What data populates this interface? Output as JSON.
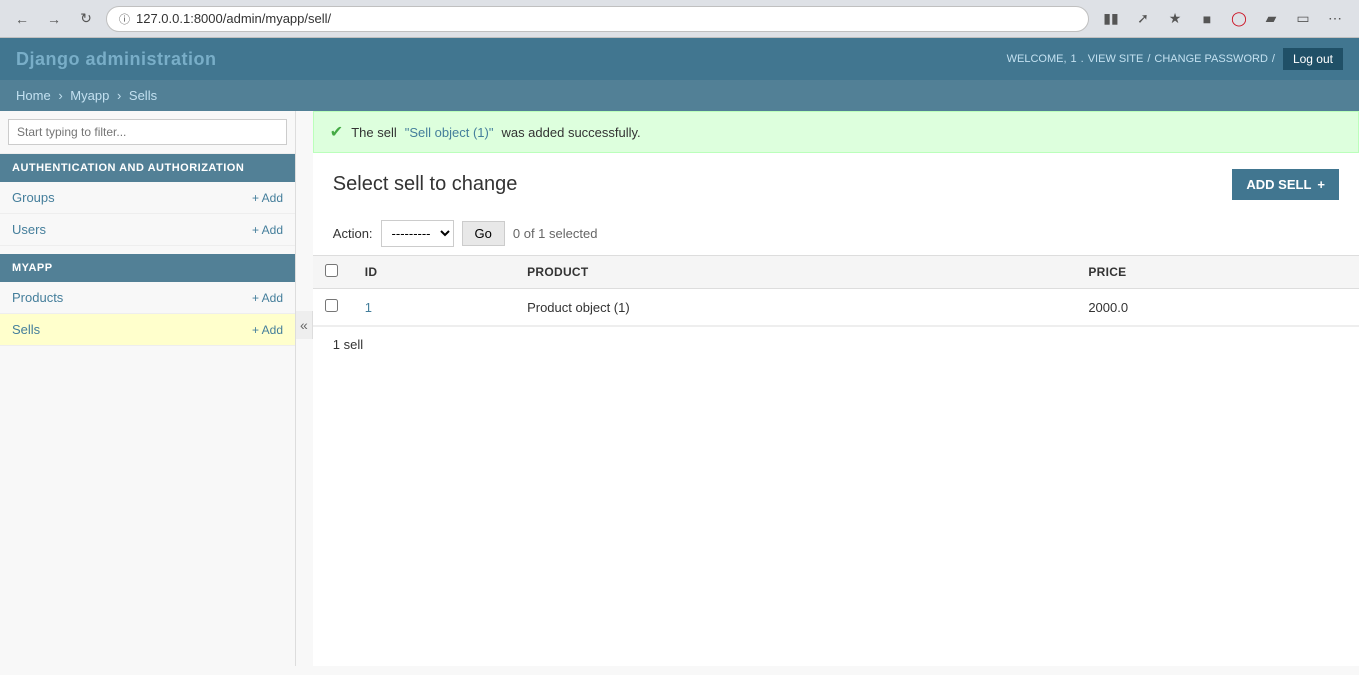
{
  "browser": {
    "url": "127.0.0.1:8000/admin/myapp/sell/",
    "url_full": "127.0.0.1:8000/admin/myapp/sell/"
  },
  "header": {
    "title": "Django administration",
    "welcome_text": "WELCOME,",
    "user_number": "1",
    "view_site": "VIEW SITE",
    "change_password": "CHANGE PASSWORD",
    "separator": "/",
    "logout_label": "Log out"
  },
  "breadcrumb": {
    "home": "Home",
    "myapp": "Myapp",
    "current": "Sells"
  },
  "sidebar": {
    "filter_placeholder": "Start typing to filter...",
    "sections": [
      {
        "name": "AUTHENTICATION AND AUTHORIZATION",
        "items": [
          {
            "label": "Groups",
            "add_label": "+ Add"
          },
          {
            "label": "Users",
            "add_label": "+ Add"
          }
        ]
      },
      {
        "name": "MYAPP",
        "items": [
          {
            "label": "Products",
            "add_label": "+ Add"
          },
          {
            "label": "Sells",
            "add_label": "+ Add",
            "active": true
          }
        ]
      }
    ],
    "collapse_icon": "«"
  },
  "success_message": {
    "text_before": "The sell",
    "link_text": "\"Sell object (1)\"",
    "text_after": "was added successfully."
  },
  "content": {
    "page_title": "Select sell to change",
    "add_button_label": "ADD SELL",
    "action_label": "Action:",
    "action_placeholder": "---------",
    "go_button": "Go",
    "selected_text": "0 of 1 selected",
    "columns": [
      {
        "key": "id",
        "label": "ID"
      },
      {
        "key": "product",
        "label": "PRODUCT"
      },
      {
        "key": "price",
        "label": "PRICE"
      }
    ],
    "rows": [
      {
        "id": "1",
        "product": "Product object (1)",
        "price": "2000.0"
      }
    ],
    "footer_text": "1 sell"
  }
}
